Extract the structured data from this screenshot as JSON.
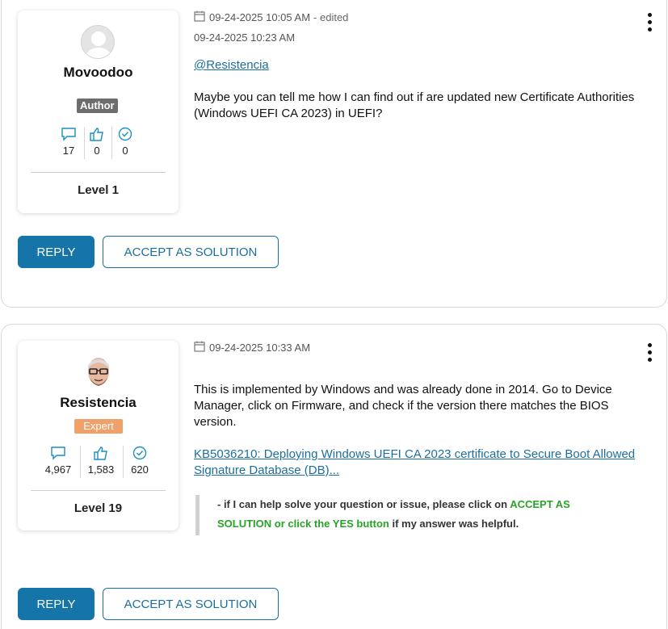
{
  "posts": [
    {
      "author": {
        "username": "Movoodoo",
        "badge": "Author",
        "level": "Level 1",
        "stats": {
          "messages": "17",
          "kudos": "0",
          "solutions": "0"
        },
        "avatar_icon": "default-avatar-icon"
      },
      "posted": "09-24-2025 10:05 AM",
      "edited_label": "- edited",
      "edited_time": "09-24-2025 10:23 AM",
      "mention": "@Resistencia",
      "message": "Maybe you can tell me how I can find out if are updated new Certificate Authorities (Windows UEFI CA 2023) in UEFI?",
      "reply_label": "REPLY",
      "accept_label": "ACCEPT AS SOLUTION"
    },
    {
      "author": {
        "username": "Resistencia",
        "badge": "Expert",
        "level": "Level 19",
        "stats": {
          "messages": "4,967",
          "kudos": "1,583",
          "solutions": "620"
        },
        "avatar_icon": "user-photo-avatar"
      },
      "posted": "09-24-2025 10:33 AM",
      "message": "This is implemented by Windows and was already done in 2014. Go to Device Manager, click on Firmware, and check if the version there matches the BIOS version.",
      "link_text": "KB5036210: Deploying Windows UEFI CA 2023 certificate to Secure Boot Allowed Signature Database (DB)...",
      "signature": {
        "prefix": "- if I can help solve your question or issue, please click on ",
        "highlight": "ACCEPT AS SOLUTION or click the YES button",
        "suffix": " if my answer was helpful."
      },
      "reply_label": "REPLY",
      "accept_label": "ACCEPT AS SOLUTION"
    }
  ],
  "colors": {
    "accent": "#1574a8",
    "author_badge": "#6d6d6d",
    "expert_badge": "#f0a069",
    "signature_green": "#27a327"
  }
}
